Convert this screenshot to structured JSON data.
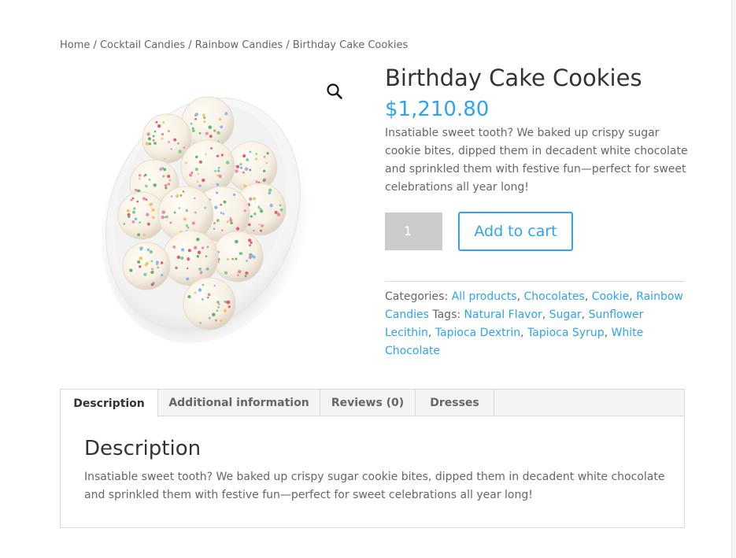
{
  "breadcrumb": {
    "home": "Home",
    "sep1": " / ",
    "cat1": "Cocktail Candies",
    "sep2": " / ",
    "cat2": "Rainbow Candies",
    "sep3": " / ",
    "current": "Birthday Cake Cookies"
  },
  "product": {
    "title": "Birthday Cake Cookies",
    "price": "$1,210.80",
    "short_description": "Insatiable sweet tooth? We baked up crispy sugar cookie bites, dipped them in decadent white chocolate and sprinkled them with festive fun—perfect for sweet celebrations all year long!",
    "quantity": "1",
    "add_to_cart_label": "Add to cart",
    "zoom_icon": "magnifier-icon"
  },
  "meta": {
    "categories_label": "Categories: ",
    "categories": [
      "All products",
      "Chocolates",
      "Cookie",
      "Rainbow Candies"
    ],
    "tags_label": " Tags: ",
    "tags": [
      "Natural Flavor",
      "Sugar",
      "Sunflower Lecithin",
      "Tapioca Dextrin",
      "Tapioca Syrup",
      "White Chocolate"
    ]
  },
  "tabs": {
    "items": [
      "Description",
      "Additional information",
      "Reviews (0)",
      "Dresses"
    ],
    "active": "Description",
    "panel_title": "Description",
    "panel_text": "Insatiable sweet tooth? We baked up crispy sugar cookie bites, dipped them in decadent white chocolate and sprinkled them with festive fun—perfect for sweet celebrations all year long!"
  },
  "colors": {
    "accent": "#2ea3f2",
    "heading": "#333333",
    "body_text": "#666666",
    "quantity_bg": "#cccccc"
  }
}
